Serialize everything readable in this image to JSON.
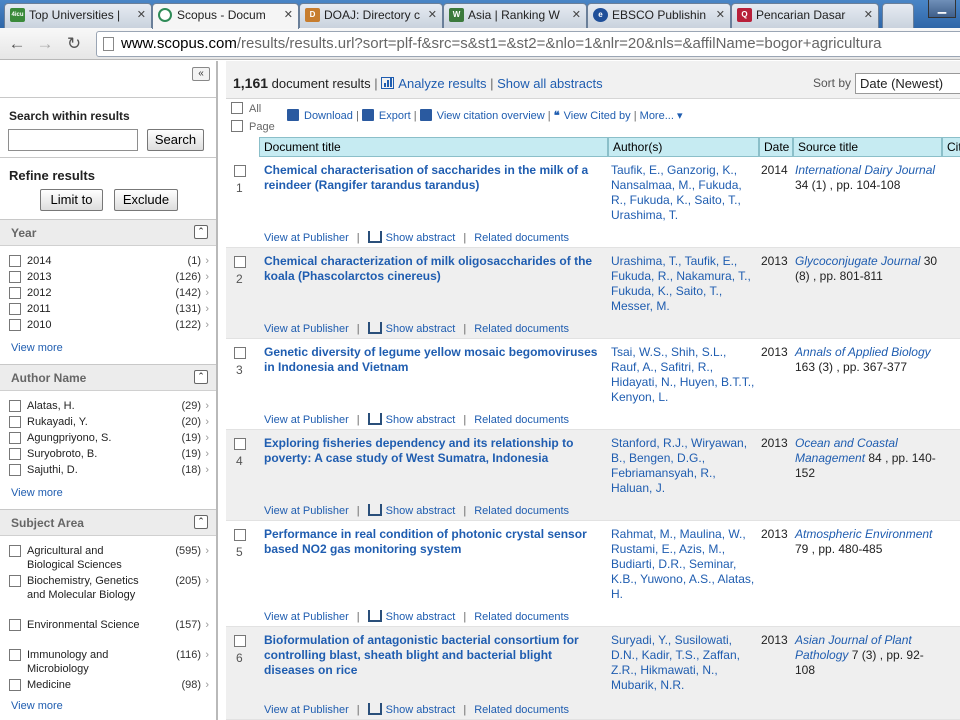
{
  "browser": {
    "tabs": [
      {
        "title": "Top Universities |",
        "favicon": "4icu-icon",
        "favicon_text": "4icu",
        "favicon_color": "#3a8a3a"
      },
      {
        "title": "Scopus - Docum",
        "favicon": "scopus-icon",
        "favicon_text": "",
        "favicon_color": "#2e8b57",
        "active": true
      },
      {
        "title": "DOAJ: Directory c",
        "favicon": "doaj-icon",
        "favicon_text": "D",
        "favicon_color": "#c77d2e"
      },
      {
        "title": "Asia | Ranking W",
        "favicon": "webometrics-icon",
        "favicon_text": "W",
        "favicon_color": "#3c7a3c"
      },
      {
        "title": "EBSCO Publishin",
        "favicon": "ebsco-icon",
        "favicon_text": "e",
        "favicon_color": "#1f4f99"
      },
      {
        "title": "Pencarian Dasar",
        "favicon": "q-icon",
        "favicon_text": "Q",
        "favicon_color": "#b8203a"
      }
    ],
    "url_host": "www.scopus.com",
    "url_path": "/results/results.url?sort=plf-f&src=s&st1=&st2=&nlo=1&nlr=20&nls=&affilName=bogor+agricultura"
  },
  "sidebar": {
    "collapse_icon": "double-chevron-left-icon",
    "search_heading": "Search within results",
    "search_value": "",
    "search_button": "Search",
    "refine_heading": "Refine results",
    "limit_button": "Limit to",
    "exclude_button": "Exclude",
    "year": {
      "title": "Year",
      "items": [
        {
          "label": "2014",
          "count": "(1)"
        },
        {
          "label": "2013",
          "count": "(126)"
        },
        {
          "label": "2012",
          "count": "(142)"
        },
        {
          "label": "2011",
          "count": "(131)"
        },
        {
          "label": "2010",
          "count": "(122)"
        }
      ],
      "view_more": "View more"
    },
    "author": {
      "title": "Author Name",
      "items": [
        {
          "label": "Alatas, H.",
          "count": "(29)"
        },
        {
          "label": "Rukayadi, Y.",
          "count": "(20)"
        },
        {
          "label": "Agungpriyono, S.",
          "count": "(19)"
        },
        {
          "label": "Suryobroto, B.",
          "count": "(19)"
        },
        {
          "label": "Sajuthi, D.",
          "count": "(18)"
        }
      ],
      "view_more": "View more"
    },
    "subject": {
      "title": "Subject Area",
      "items": [
        {
          "label": "Agricultural and Biological Sciences",
          "count": "(595)"
        },
        {
          "label": "Biochemistry, Genetics and Molecular Biology",
          "count": "(205)"
        },
        {
          "label": "Environmental Science",
          "count": "(157)"
        },
        {
          "label": "Immunology and Microbiology",
          "count": "(116)"
        },
        {
          "label": "Medicine",
          "count": "(98)"
        }
      ],
      "view_more": "View more"
    }
  },
  "main": {
    "count": "1,161",
    "count_label": "document results",
    "analyze": "Analyze results",
    "show_abstracts": "Show all abstracts",
    "sort_label": "Sort by",
    "sort_value": "Date (Newest)",
    "select_all": "All",
    "select_page": "Page",
    "actions": [
      "Download",
      "Export",
      "View citation overview",
      "View Cited by",
      "More..."
    ],
    "columns": [
      "Document title",
      "Author(s)",
      "Date",
      "Source title",
      "Cit"
    ],
    "row_links": [
      "View at Publisher",
      "Show abstract",
      "Related documents"
    ],
    "results": [
      {
        "num": "1",
        "title": "Chemical characterisation of saccharides in the milk of a reindeer (Rangifer tarandus tarandus)",
        "authors": "Taufik, E., Ganzorig, K., Nansalmaa, M., Fukuda, R., Fukuda, K., Saito, T., Urashima, T.",
        "date": "2014",
        "source_title": "International Dairy Journal",
        "source_detail": " 34 (1) , pp. 104-108"
      },
      {
        "num": "2",
        "title": "Chemical characterization of milk oligosaccharides of the koala (Phascolarctos cinereus)",
        "authors": "Urashima, T., Taufik, E., Fukuda, R., Nakamura, T., Fukuda, K., Saito, T., Messer, M.",
        "date": "2013",
        "source_title": "Glycoconjugate Journal",
        "source_detail": " 30 (8) , pp. 801-811"
      },
      {
        "num": "3",
        "title": "Genetic diversity of legume yellow mosaic begomoviruses in Indonesia and Vietnam",
        "authors": "Tsai, W.S., Shih, S.L., Rauf, A., Safitri, R., Hidayati, N., Huyen, B.T.T., Kenyon, L.",
        "date": "2013",
        "source_title": "Annals of Applied Biology",
        "source_detail": " 163 (3) , pp. 367-377"
      },
      {
        "num": "4",
        "title": "Exploring fisheries dependency and its relationship to poverty: A case study of West Sumatra, Indonesia",
        "authors": "Stanford, R.J., Wiryawan, B., Bengen, D.G., Febriamansyah, R., Haluan, J.",
        "date": "2013",
        "source_title": "Ocean and Coastal Management",
        "source_detail": " 84 , pp. 140-152"
      },
      {
        "num": "5",
        "title": "Performance in real condition of photonic crystal sensor based NO2 gas monitoring system",
        "authors": "Rahmat, M., Maulina, W., Rustami, E., Azis, M., Budiarti, D.R., Seminar, K.B., Yuwono, A.S., Alatas, H.",
        "date": "2013",
        "source_title": "Atmospheric Environment",
        "source_detail": " 79 , pp. 480-485"
      },
      {
        "num": "6",
        "title": "Bioformulation of antagonistic bacterial consortium for controlling blast, sheath blight and bacterial blight diseases on rice",
        "authors": "Suryadi, Y., Susilowati, D.N., Kadir, T.S., Zaffan, Z.R., Hikmawati, N., Mubarik, N.R.",
        "date": "2013",
        "source_title": "Asian Journal of Plant Pathology",
        "source_detail": " 7 (3) , pp. 92-108"
      }
    ]
  }
}
